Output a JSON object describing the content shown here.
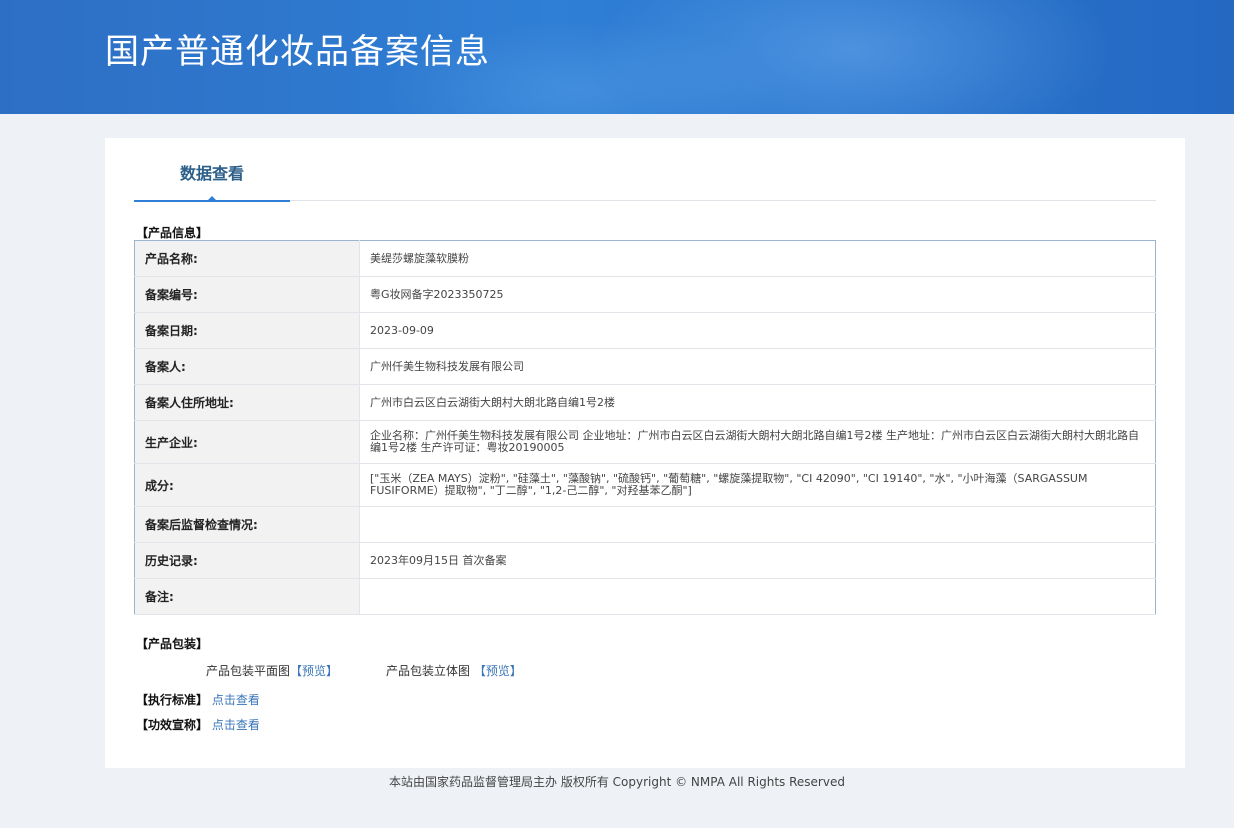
{
  "banner": {
    "title": "国产普通化妆品备案信息"
  },
  "tab": {
    "label": "数据查看"
  },
  "product_info": {
    "section_title": "【产品信息】",
    "rows": [
      {
        "label": "产品名称:",
        "value": "美缇莎螺旋藻软膜粉"
      },
      {
        "label": "备案编号:",
        "value": "粤G妆网备字2023350725"
      },
      {
        "label": "备案日期:",
        "value": "2023-09-09"
      },
      {
        "label": "备案人:",
        "value": "广州仟美生物科技发展有限公司"
      },
      {
        "label": "备案人住所地址:",
        "value": "广州市白云区白云湖街大朗村大朗北路自编1号2楼"
      },
      {
        "label": "生产企业:",
        "value": "企业名称：广州仟美生物科技发展有限公司 企业地址：广州市白云区白云湖街大朗村大朗北路自编1号2楼 生产地址：广州市白云区白云湖街大朗村大朗北路自编1号2楼 生产许可证：粤妆20190005"
      },
      {
        "label": "成分:",
        "value": "[\"玉米（ZEA MAYS）淀粉\", \"硅藻土\", \"藻酸钠\", \"硫酸钙\", \"葡萄糖\", \"螺旋藻提取物\", \"CI 42090\", \"CI 19140\", \"水\", \"小叶海藻（SARGASSUM FUSIFORME）提取物\", \"丁二醇\", \"1,2-己二醇\", \"对羟基苯乙酮\"]"
      },
      {
        "label": "备案后监督检查情况:",
        "value": ""
      },
      {
        "label": "历史记录:",
        "value": "2023年09月15日 首次备案"
      },
      {
        "label": "备注:",
        "value": ""
      }
    ]
  },
  "packaging": {
    "section_title": "【产品包装】",
    "flat_label": "产品包装平面图",
    "flat_link": "【预览】",
    "solid_label": "产品包装立体图",
    "solid_link": "【预览】"
  },
  "standard": {
    "label": "【执行标准】",
    "link": "点击查看"
  },
  "efficacy": {
    "label": "【功效宣称】",
    "link": "点击查看"
  },
  "footer": {
    "text": "本站由国家药品监督管理局主办 版权所有 Copyright © NMPA All Rights Reserved"
  }
}
